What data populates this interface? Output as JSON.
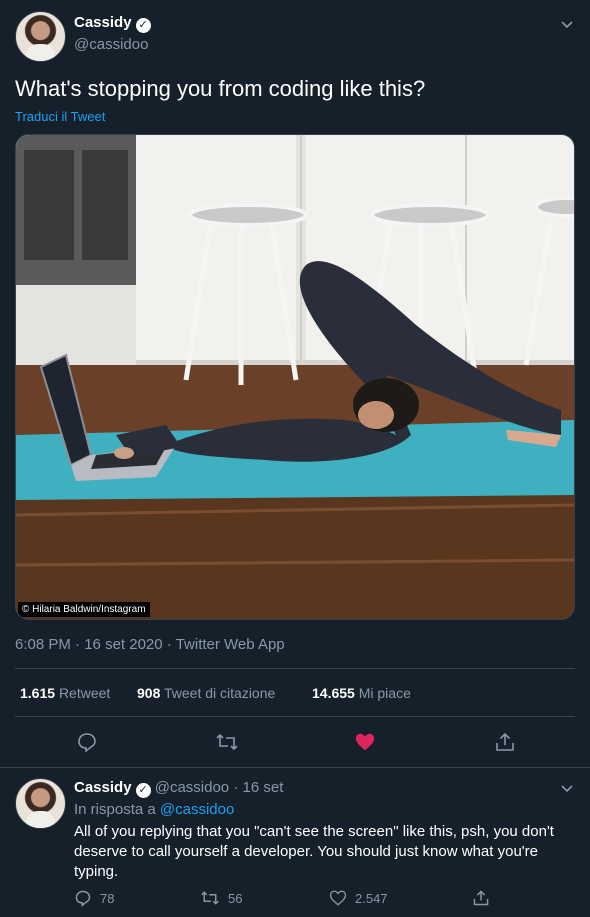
{
  "tweet": {
    "author": {
      "name": "Cassidy",
      "handle": "@cassidoo"
    },
    "text": "What's stopping you from coding like this?",
    "translate_label": "Traduci il Tweet",
    "image_credit": "© Hilaria Baldwin/Instagram",
    "meta": {
      "time": "6:08 PM",
      "sep1": "·",
      "date": "16 set 2020",
      "sep2": "·",
      "source": "Twitter Web App"
    },
    "stats": [
      {
        "value": "1.615",
        "label": "Retweet"
      },
      {
        "value": "908",
        "label": "Tweet di citazione"
      },
      {
        "value": "14.655",
        "label": "Mi piace"
      }
    ],
    "actions": {
      "like_color": "#e0245e"
    }
  },
  "reply": {
    "author": {
      "name": "Cassidy",
      "handle": "@cassidoo",
      "sep": "·",
      "date": "16 set"
    },
    "in_reply_prefix": "In risposta a",
    "in_reply_handle": "@cassidoo",
    "text": "All of you replying that you \"can't see the screen\" like this, psh, you don't deserve to call yourself a developer. You should just know what you're typing.",
    "counts": {
      "replies": "78",
      "retweets": "56",
      "likes": "2.547"
    }
  },
  "colors": {
    "background": "#15202b",
    "muted": "#8899a6",
    "accent": "#1da1f2"
  }
}
